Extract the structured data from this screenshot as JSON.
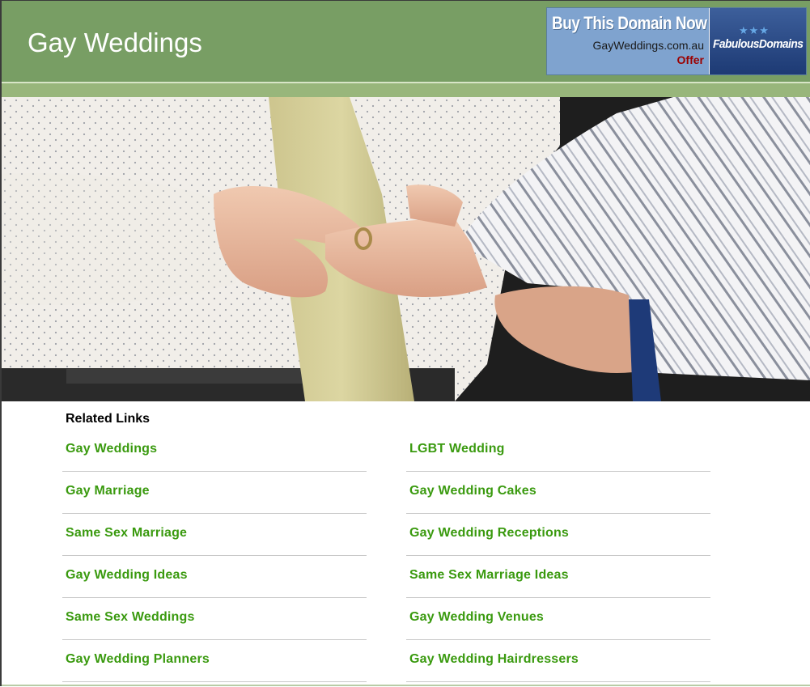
{
  "header": {
    "title": "Gay Weddings",
    "background_color": "#789e64"
  },
  "ad": {
    "headline": "Buy This Domain Now",
    "domain": "GayWeddings.com.au",
    "offer": "Offer",
    "brand": "FabulousDomains",
    "stars_icon": "three-stars-icon"
  },
  "hero": {
    "image": "photo of two men exchanging a wedding ring"
  },
  "related": {
    "heading": "Related Links",
    "link_color": "#3a9a0f",
    "left": [
      "Gay Weddings",
      "Gay Marriage",
      "Same Sex Marriage",
      "Gay Wedding Ideas",
      "Same Sex Weddings",
      "Gay Wedding Planners"
    ],
    "right": [
      "LGBT Wedding",
      "Gay Wedding Cakes",
      "Gay Wedding Receptions",
      "Same Sex Marriage Ideas",
      "Gay Wedding Venues",
      "Gay Wedding Hairdressers"
    ]
  }
}
